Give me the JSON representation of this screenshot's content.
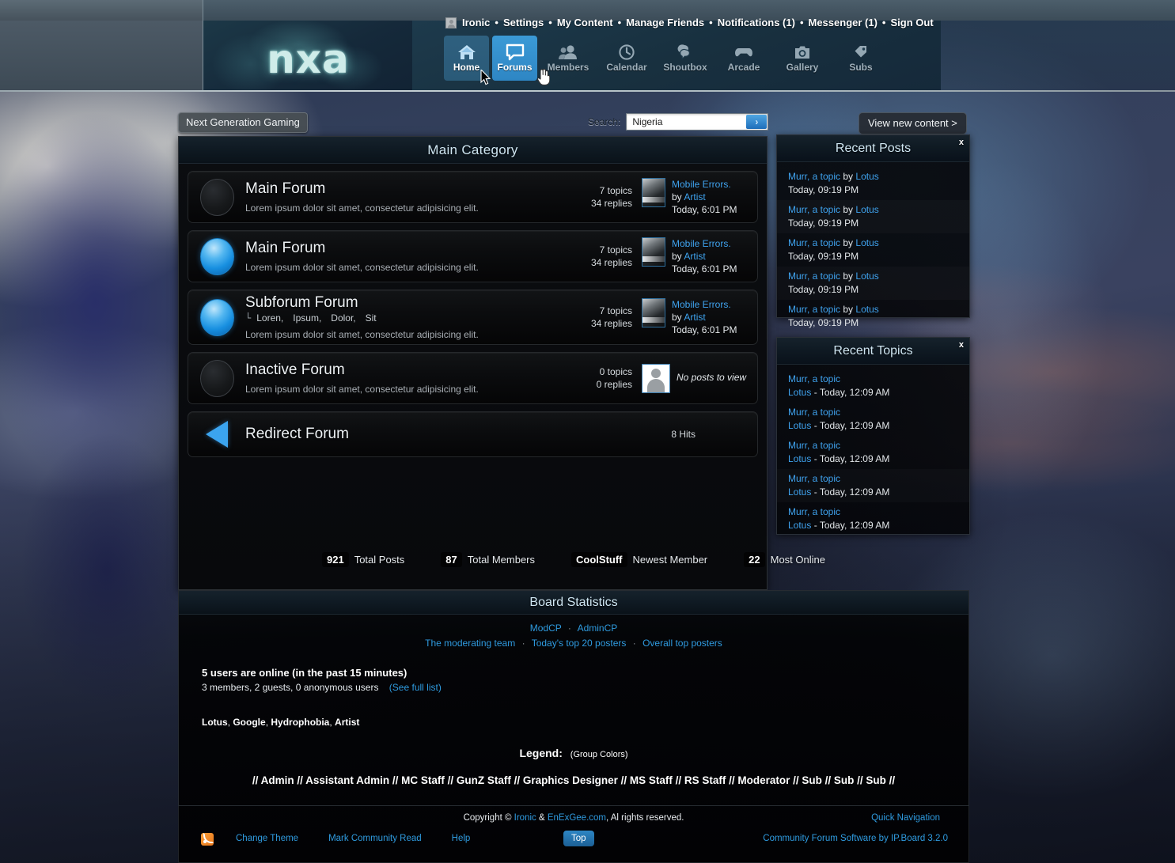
{
  "site": {
    "logo_text": "nxa",
    "colors": {
      "accent_blue": "#3fa3ef",
      "link_blue": "#2f9be0",
      "header_teal": "#cfe6f2",
      "tab_active": "#2e86c4"
    }
  },
  "header": {
    "user_links": [
      {
        "label": "Ironic"
      },
      {
        "label": "Settings"
      },
      {
        "label": "My Content"
      },
      {
        "label": "Manage Friends"
      },
      {
        "label": "Notifications (1)"
      },
      {
        "label": "Messenger (1)"
      },
      {
        "label": "Sign Out"
      }
    ],
    "separator": "•",
    "nav_tabs": [
      {
        "label": "Home",
        "icon": "home-icon",
        "state": "hover"
      },
      {
        "label": "Forums",
        "icon": "speech-bubble-icon",
        "state": "active"
      },
      {
        "label": "Members",
        "icon": "people-icon",
        "state": "normal"
      },
      {
        "label": "Calendar",
        "icon": "clock-icon",
        "state": "normal"
      },
      {
        "label": "Shoutbox",
        "icon": "shout-bubble-icon",
        "state": "normal"
      },
      {
        "label": "Arcade",
        "icon": "gamepad-icon",
        "state": "normal"
      },
      {
        "label": "Gallery",
        "icon": "camera-icon",
        "state": "normal"
      },
      {
        "label": "Subs",
        "icon": "tag-icon",
        "state": "normal"
      }
    ]
  },
  "breadcrumb": {
    "label": "Next Generation Gaming"
  },
  "search": {
    "label": "Search:",
    "value": "Nigeria",
    "placeholder": "Search",
    "go_label": "›"
  },
  "view_new_content": {
    "label": "View new content >"
  },
  "category": {
    "title": "Main Category",
    "forums": [
      {
        "type": "forum",
        "icon": "forum-orb-inactive",
        "title": "Main Forum",
        "description": "Lorem ipsum dolor sit amet, consectetur adipisicing elit.",
        "topics": "7 topics",
        "replies": "34 replies",
        "last_post_title": "Mobile Errors.",
        "last_post_by_prefix": "by",
        "last_post_author": "Artist",
        "last_post_time": "Today, 6:01 PM"
      },
      {
        "type": "forum",
        "icon": "forum-orb-active",
        "title": "Main Forum",
        "description": "Lorem ipsum dolor sit amet, consectetur adipisicing elit.",
        "topics": "7 topics",
        "replies": "34 replies",
        "last_post_title": "Mobile Errors.",
        "last_post_by_prefix": "by",
        "last_post_author": "Artist",
        "last_post_time": "Today, 6:01 PM"
      },
      {
        "type": "forum-with-subforums",
        "icon": "forum-orb-active",
        "title": "Subforum Forum",
        "subforum_marker": "└",
        "subforums": [
          "Loren,",
          "Ipsum,",
          "Dolor,",
          "Sit"
        ],
        "description": "Lorem ipsum dolor sit amet, consectetur adipisicing elit.",
        "topics": "7 topics",
        "replies": "34 replies",
        "last_post_title": "Mobile Errors.",
        "last_post_by_prefix": "by",
        "last_post_author": "Artist",
        "last_post_time": "Today, 6:01 PM"
      },
      {
        "type": "forum-inactive",
        "icon": "forum-orb-inactive",
        "title": "Inactive Forum",
        "description": "Lorem ipsum dolor sit amet, consectetur adipisicing elit.",
        "topics": "0 topics",
        "replies": "0 replies",
        "no_posts_label": "No posts to view"
      },
      {
        "type": "redirect",
        "icon": "redirect-arrow-icon",
        "title": "Redirect Forum",
        "hits": "8 Hits"
      }
    ]
  },
  "recent_posts": {
    "title": "Recent Posts",
    "close_label": "x",
    "items": [
      {
        "topic": "Murr, a topic",
        "by": "by",
        "author": "Lotus",
        "time": "Today, 09:19 PM"
      },
      {
        "topic": "Murr, a topic",
        "by": "by",
        "author": "Lotus",
        "time": "Today, 09:19 PM"
      },
      {
        "topic": "Murr, a topic",
        "by": "by",
        "author": "Lotus",
        "time": "Today, 09:19 PM"
      },
      {
        "topic": "Murr, a topic",
        "by": "by",
        "author": "Lotus",
        "time": "Today, 09:19 PM"
      },
      {
        "topic": "Murr, a topic",
        "by": "by",
        "author": "Lotus",
        "time": "Today, 09:19 PM"
      }
    ]
  },
  "recent_topics": {
    "title": "Recent Topics",
    "close_label": "x",
    "items": [
      {
        "topic": "Murr, a topic",
        "author": "Lotus",
        "time": "- Today, 12:09 AM"
      },
      {
        "topic": "Murr, a topic",
        "author": "Lotus",
        "time": "- Today, 12:09 AM"
      },
      {
        "topic": "Murr, a topic",
        "author": "Lotus",
        "time": "- Today, 12:09 AM"
      },
      {
        "topic": "Murr, a topic",
        "author": "Lotus",
        "time": "- Today, 12:09 AM"
      },
      {
        "topic": "Murr, a topic",
        "author": "Lotus",
        "time": "- Today, 12:09 AM"
      }
    ]
  },
  "stats_strip": [
    {
      "value": "921",
      "label": "Total Posts"
    },
    {
      "value": "87",
      "label": "Total Members"
    },
    {
      "value": "CoolStuff",
      "label": "Newest Member"
    },
    {
      "value": "22",
      "label": "Most Online"
    }
  ],
  "board_statistics": {
    "title": "Board Statistics",
    "cp_links": [
      {
        "label": "ModCP"
      },
      {
        "label": "AdminCP"
      }
    ],
    "team_links": [
      {
        "label": "The moderating team"
      },
      {
        "label": "Today's top 20 posters"
      },
      {
        "label": "Overall top posters"
      }
    ],
    "dot": "·",
    "online_heading": "5 users are online (in the past 15 minutes)",
    "online_breakdown": "3 members, 2 guests, 0 anonymous users",
    "see_full_list": "(See full list)",
    "online_users": [
      {
        "name": "Lotus"
      },
      {
        "name": "Google"
      },
      {
        "name": "Hydrophobia"
      },
      {
        "name": "Artist"
      }
    ],
    "legend_label": "Legend:",
    "legend_note": "(Group Colors)",
    "groups_line": "// Admin // Assistant Admin // MC Staff // GunZ Staff // Graphics Designer // MS Staff // RS Staff // Moderator // Sub // Sub // Sub //"
  },
  "footer": {
    "copyright_prefix": "Copyright © ",
    "copyright_link1": "Ironic",
    "copyright_amp": " & ",
    "copyright_link2": "EnExGee.com",
    "copyright_suffix": ", Al rights reserved.",
    "quick_navigation": "Quick Navigation",
    "links": [
      {
        "label": "Change Theme"
      },
      {
        "label": "Mark Community Read"
      },
      {
        "label": "Help"
      }
    ],
    "top_button": "Top",
    "ipboard": "Community Forum Software by IP.Board 3.2.0",
    "rss_icon": "rss-icon"
  }
}
